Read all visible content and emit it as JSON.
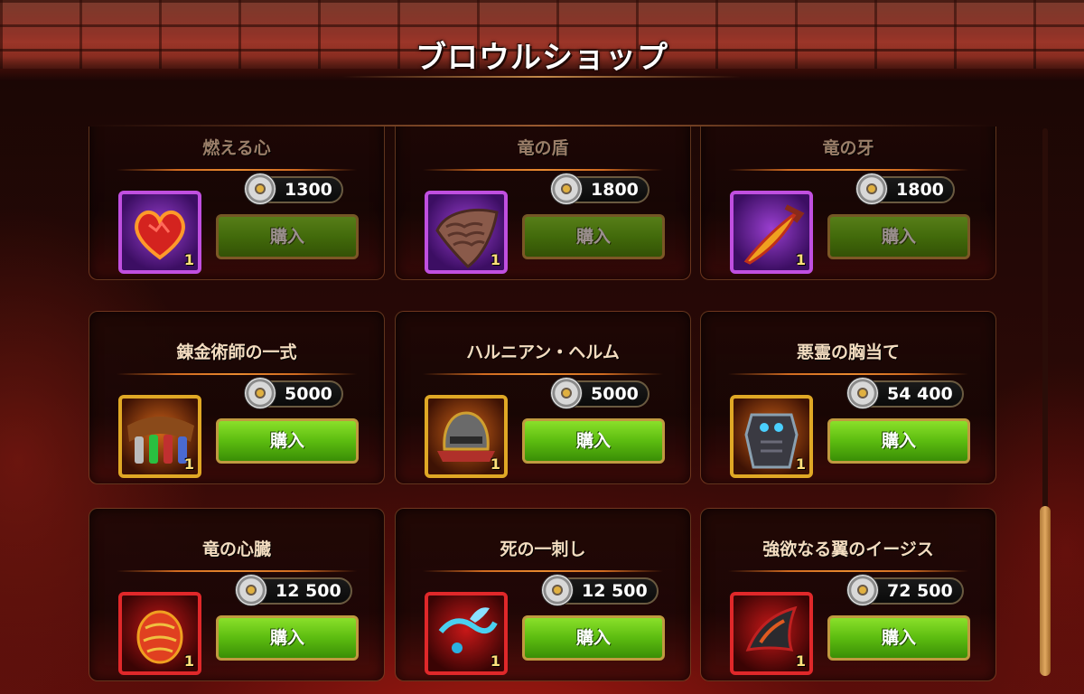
{
  "title": "ブロウルショップ",
  "buy_label": "購入",
  "items": [
    {
      "name": "燃える心",
      "price": "1300",
      "qty": "1",
      "rarity": "purple",
      "icon": "burning-heart-icon"
    },
    {
      "name": "竜の盾",
      "price": "1800",
      "qty": "1",
      "rarity": "purple",
      "icon": "dragon-shield-icon"
    },
    {
      "name": "竜の牙",
      "price": "1800",
      "qty": "1",
      "rarity": "purple",
      "icon": "dragon-fang-icon"
    },
    {
      "name": "錬金術師の一式",
      "price": "5000",
      "qty": "1",
      "rarity": "gold",
      "icon": "alchemist-kit-icon"
    },
    {
      "name": "ハルニアン・ヘルム",
      "price": "5000",
      "qty": "1",
      "rarity": "gold",
      "icon": "helm-icon"
    },
    {
      "name": "悪霊の胸当て",
      "price": "54 400",
      "qty": "1",
      "rarity": "gold",
      "icon": "breastplate-icon"
    },
    {
      "name": "竜の心臓",
      "price": "12 500",
      "qty": "1",
      "rarity": "red",
      "icon": "dragon-heart-icon"
    },
    {
      "name": "死の一刺し",
      "price": "12 500",
      "qty": "1",
      "rarity": "red",
      "icon": "death-sting-icon"
    },
    {
      "name": "強欲なる翼のイージス",
      "price": "72 500",
      "qty": "1",
      "rarity": "red",
      "icon": "winged-aegis-icon"
    }
  ],
  "colors": {
    "buy_button": "#5cbc10",
    "purple_frame": "#c04fe0",
    "gold_frame": "#e0a825",
    "red_frame": "#e0282a"
  }
}
